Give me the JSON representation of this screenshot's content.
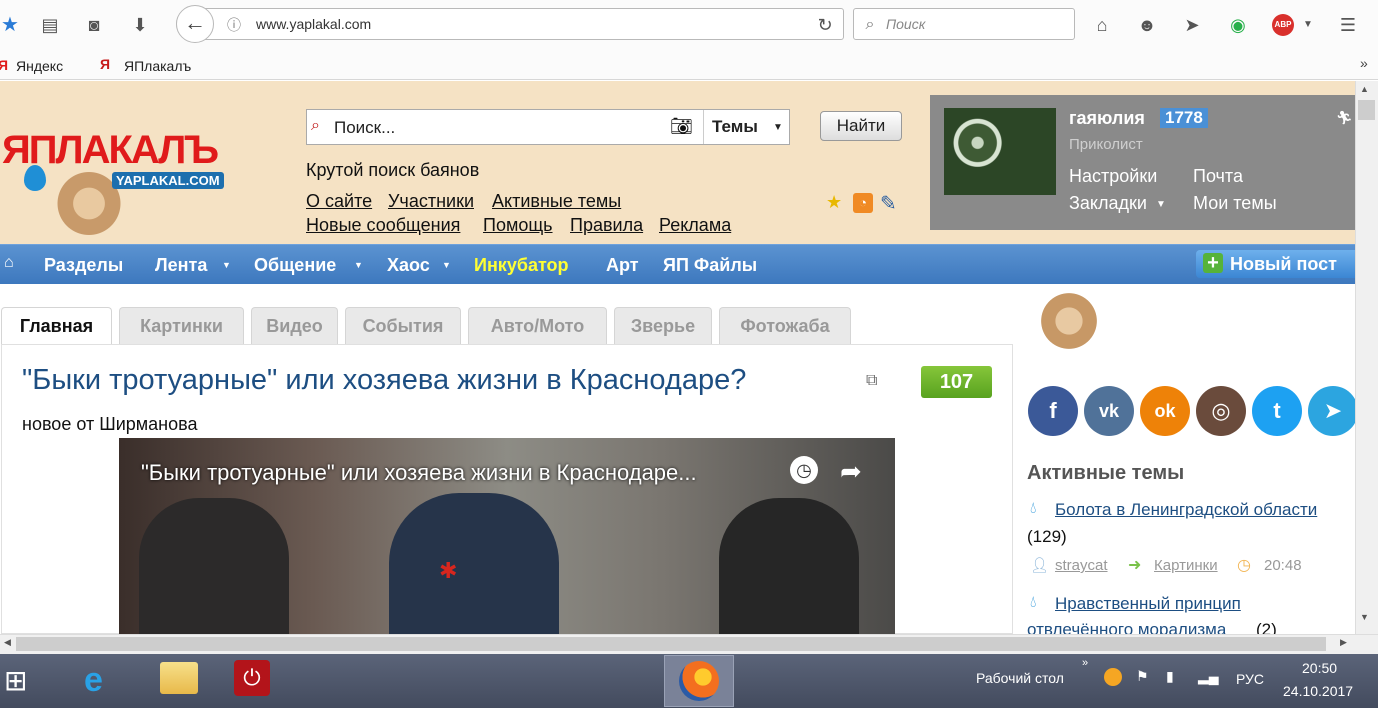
{
  "browser": {
    "url": "www.yaplakal.com",
    "search_placeholder": "Поиск",
    "bookmarks": [
      "Яндекс",
      "ЯПлакалъ"
    ],
    "overflow": "»",
    "abp_badge": "ABP"
  },
  "site": {
    "logo_text": "ЯПЛАКАЛЪ",
    "logo_sub": "YAPLAKAL.COM",
    "search_placeholder": "Поиск...",
    "search_scope": "Темы",
    "find_button": "Найти",
    "cool_search": "Крутой поиск баянов",
    "header_links": [
      [
        "О сайте",
        "Участники",
        "Активные темы"
      ],
      [
        "Новые сообщения",
        "Помощь",
        "Правила",
        "Реклама"
      ]
    ]
  },
  "user": {
    "name": "гаяюлия",
    "score": "1778",
    "rank": "Приколист",
    "links": [
      "Настройки",
      "Почта",
      "Закладки",
      "Мои темы"
    ]
  },
  "nav": {
    "items": [
      "Разделы",
      "Лента",
      "Общение",
      "Хаос",
      "Инкубатор",
      "Арт",
      "ЯП Файлы"
    ],
    "new_post": "Новый пост",
    "highlight_color": "#ffff33"
  },
  "tabs": [
    "Главная",
    "Картинки",
    "Видео",
    "События",
    "Авто/Мото",
    "Зверье",
    "Фотожаба"
  ],
  "post": {
    "title": "\"Быки тротуарные\" или хозяева жизни в Краснодаре?",
    "count": "107",
    "subtitle": "новое от Ширманова",
    "video_title": "\"Быки тротуарные\" или хозяева жизни в Краснодаре..."
  },
  "social": [
    {
      "icon": "facebook-icon",
      "glyph": "f",
      "color": "#3b5998"
    },
    {
      "icon": "vk-icon",
      "glyph": "vk",
      "color": "#507299"
    },
    {
      "icon": "odnoklassniki-icon",
      "glyph": "ok",
      "color": "#ee8208"
    },
    {
      "icon": "instagram-icon",
      "glyph": "◎",
      "color": "#6a4b3c"
    },
    {
      "icon": "twitter-icon",
      "glyph": "t",
      "color": "#1da1f2"
    },
    {
      "icon": "telegram-icon",
      "glyph": "➤",
      "color": "#2ca5e0"
    }
  ],
  "active_topics": {
    "title": "Активные темы",
    "items": [
      {
        "title": "Болота в Ленинградской области",
        "count": "(129)",
        "author": "straycat",
        "section": "Картинки",
        "time": "20:48"
      },
      {
        "title": "Нравственный принцип",
        "title2": "отвлечённого морализма",
        "count": "(2)"
      }
    ]
  },
  "taskbar": {
    "desktop_label": "Рабочий стол",
    "language": "РУС",
    "time": "20:50",
    "date": "24.10.2017"
  }
}
